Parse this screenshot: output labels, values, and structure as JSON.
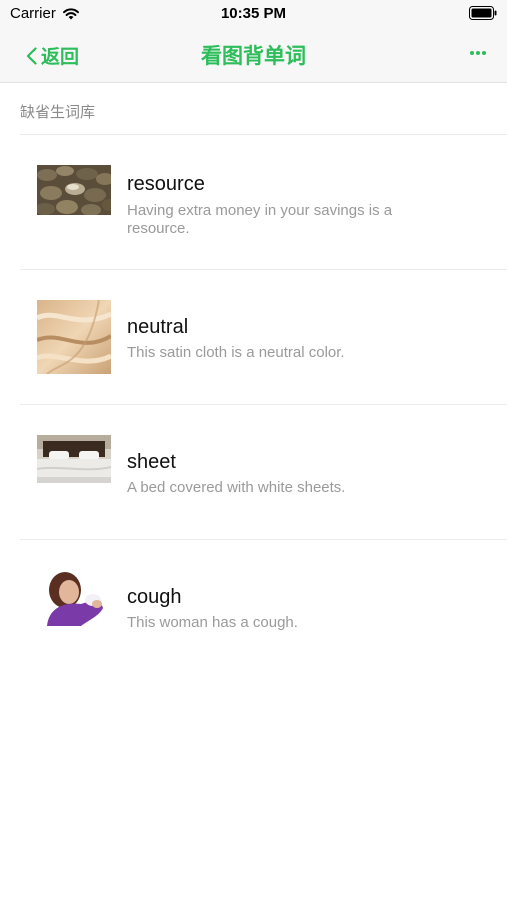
{
  "status_bar": {
    "carrier": "Carrier",
    "time": "10:35 PM"
  },
  "nav": {
    "back_label": "返回",
    "title": "看图背单词",
    "accent_color": "#2dbd5a"
  },
  "section": {
    "header": "缺省生词库"
  },
  "words": [
    {
      "word": "resource",
      "sentence": "Having extra money in your savings is a resource.",
      "image": "coins-image"
    },
    {
      "word": "neutral",
      "sentence": "This satin cloth is a neutral color.",
      "image": "satin-cloth-image"
    },
    {
      "word": "sheet",
      "sentence": "A bed covered with white sheets.",
      "image": "bed-image"
    },
    {
      "word": "cough",
      "sentence": "This woman has a cough.",
      "image": "coughing-woman-image"
    }
  ]
}
